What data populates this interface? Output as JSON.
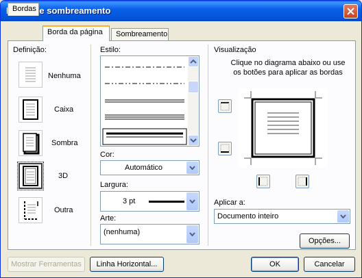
{
  "window": {
    "title": "Bordas e sombreamento"
  },
  "tabs": [
    {
      "label": "Bordas",
      "active": false
    },
    {
      "label": "Borda da página",
      "active": true
    },
    {
      "label": "Sombreamento",
      "active": false
    }
  ],
  "definicao": {
    "label": "Definição:",
    "items": [
      {
        "label": "Nenhuma",
        "icon": "border-none-icon",
        "selected": false
      },
      {
        "label": "Caixa",
        "icon": "border-box-icon",
        "selected": false
      },
      {
        "label": "Sombra",
        "icon": "border-shadow-icon",
        "selected": false
      },
      {
        "label": "3D",
        "icon": "border-3d-icon",
        "selected": true
      },
      {
        "label": "Outra",
        "icon": "border-custom-icon",
        "selected": false
      }
    ]
  },
  "estilo": {
    "label": "Estilo:",
    "line_styles": [
      "dash-dot",
      "dash-dot-dot",
      "double",
      "triple",
      "thick-thin (selected)"
    ]
  },
  "cor": {
    "label": "Cor:",
    "value": "Automático"
  },
  "largura": {
    "label": "Largura:",
    "value": "3 pt"
  },
  "arte": {
    "label": "Arte:",
    "value": "(nenhuma)"
  },
  "visualizacao": {
    "label": "Visualização",
    "hint": "Clique no diagrama abaixo ou use os botões para aplicar as bordas"
  },
  "aplicar": {
    "label": "Aplicar a:",
    "value": "Documento inteiro"
  },
  "buttons": {
    "opcoes": "Opções...",
    "mostrar_ferramentas": "Mostrar Ferramentas",
    "linha_horizontal": "Linha Horizontal...",
    "ok": "OK",
    "cancelar": "Cancelar"
  },
  "colors": {
    "titlebar": "#0a5fe8",
    "tab_highlight": "#f8b334",
    "dialog_bg": "#ece9d8"
  }
}
